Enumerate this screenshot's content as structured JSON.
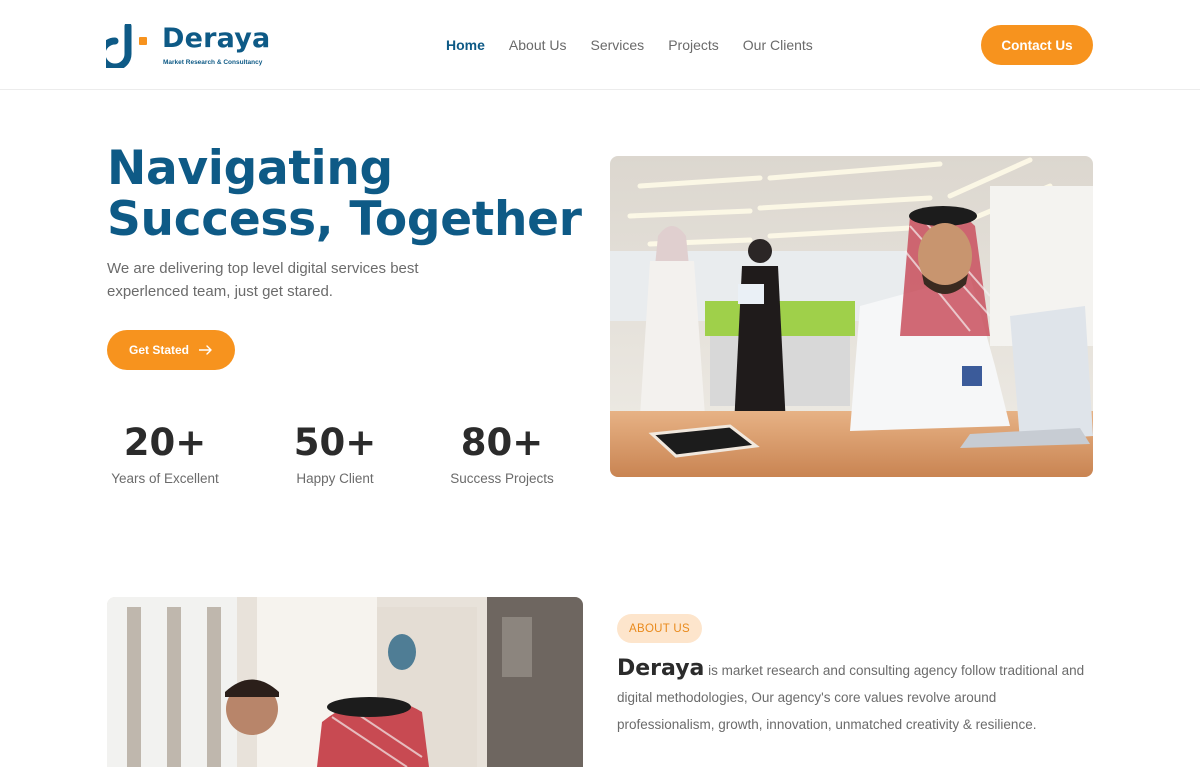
{
  "brand": {
    "name": "Deraya",
    "tagline": "Market Research & Consultancy",
    "logo_icon": "deraya-logo-mark",
    "primary_color": "#0e5a86",
    "accent_color": "#f7931e"
  },
  "nav": {
    "items": [
      {
        "label": "Home",
        "active": true
      },
      {
        "label": "About Us",
        "active": false
      },
      {
        "label": "Services",
        "active": false
      },
      {
        "label": "Projects",
        "active": false
      },
      {
        "label": "Our Clients",
        "active": false
      }
    ],
    "contact_label": "Contact Us"
  },
  "hero": {
    "title_line1": "Navigating",
    "title_line2": "Success, Together",
    "subtitle": "We are delivering top level digital services best experlenced team, just get stared.",
    "cta_label": "Get Stated",
    "cta_icon": "arrow-right-icon",
    "stats": [
      {
        "value": "20+",
        "label": "Years of Excellent"
      },
      {
        "value": "50+",
        "label": "Happy Client"
      },
      {
        "value": "80+",
        "label": "Success Projects"
      }
    ]
  },
  "about": {
    "badge": "ABOUT US",
    "brand": "Deraya",
    "text": " is market research and consulting agency follow traditional and digital methodologies, Our agency's core values revolve around professionalism, growth, innovation, unmatched creativity & resilience."
  }
}
